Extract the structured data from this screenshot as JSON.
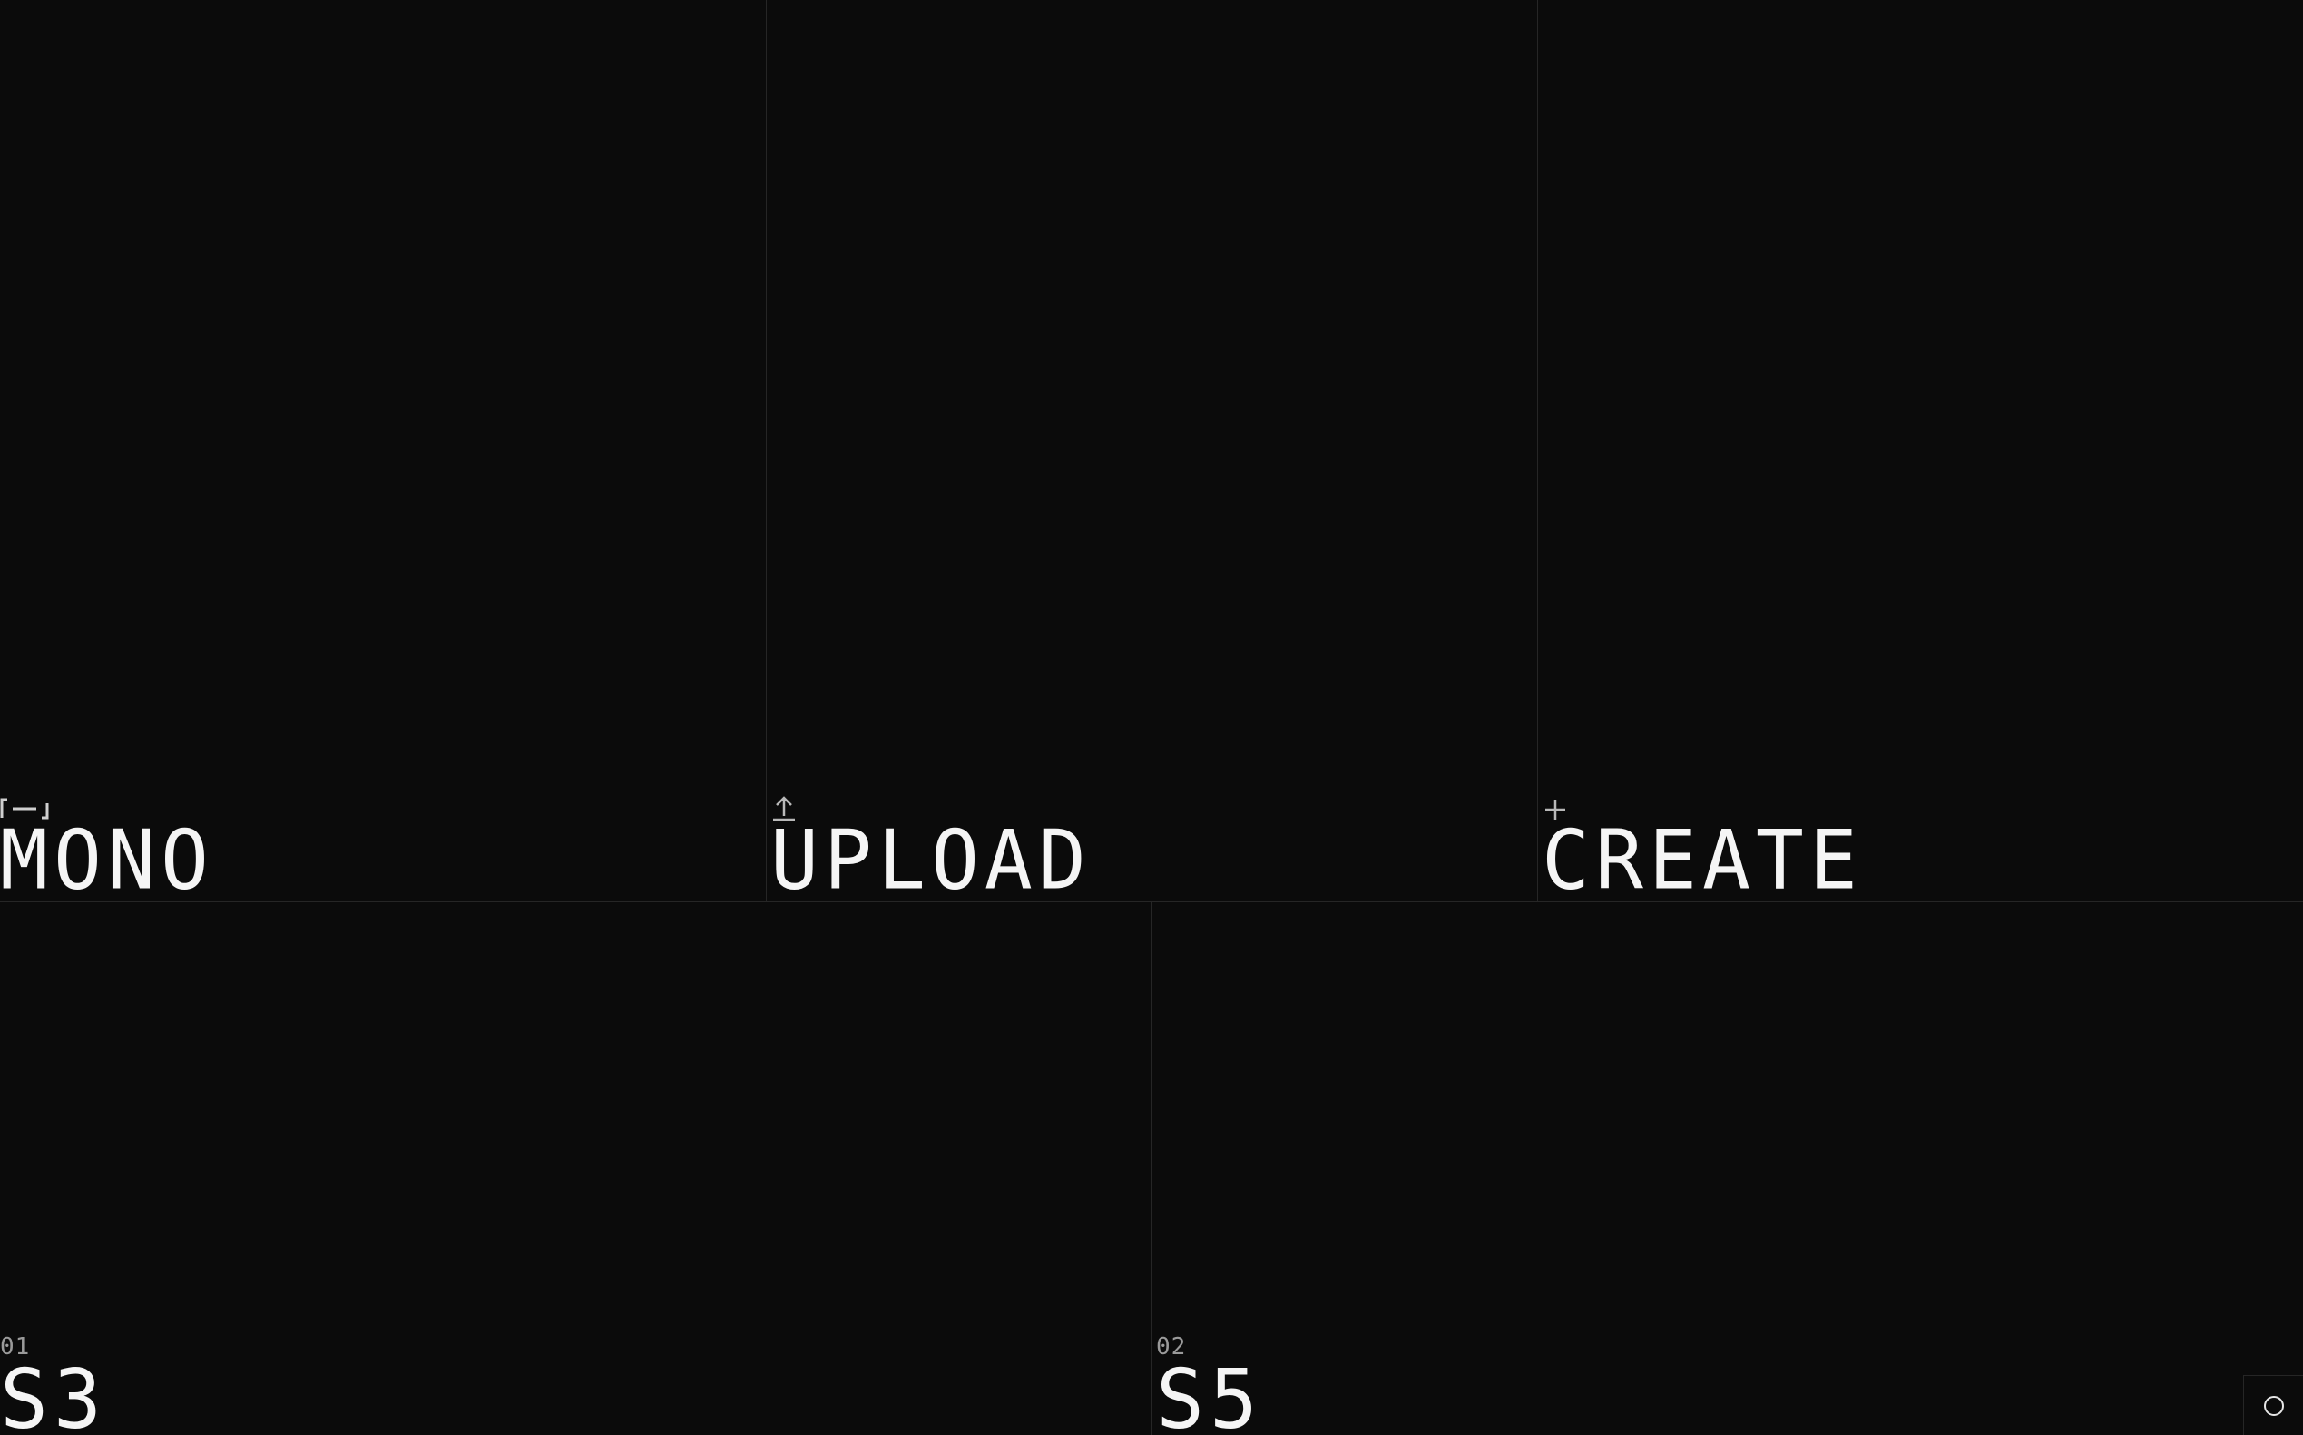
{
  "tiles_top": [
    {
      "icon": "bracket-dash-icon",
      "title": "MONO"
    },
    {
      "icon": "upload-arrow-icon",
      "title": "UPLOAD"
    },
    {
      "icon": "plus-icon",
      "title": "CREATE"
    }
  ],
  "tiles_bottom": [
    {
      "index": "01",
      "title": "S3"
    },
    {
      "index": "02",
      "title": "S5"
    }
  ],
  "corner_button": {
    "icon": "circle-icon"
  },
  "colors": {
    "background": "#0b0b0b",
    "divider": "#262626",
    "text": "#f5f5f5",
    "muted": "#9a9a9a"
  }
}
